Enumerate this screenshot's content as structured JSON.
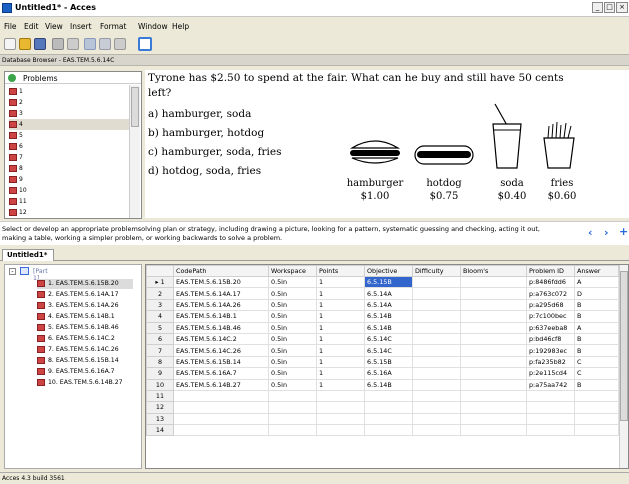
{
  "window": {
    "title": "Untitled1* - Acces",
    "min": "_",
    "max": "□",
    "close": "×"
  },
  "menu": [
    "File",
    "Edit",
    "View",
    "Insert",
    "Format",
    "Window",
    "Help"
  ],
  "database_browser": "Database Browser - EAS.TEM.5.6.14C",
  "problems": {
    "title": "Problems",
    "items": [
      "1",
      "2",
      "3",
      "4",
      "5",
      "6",
      "7",
      "8",
      "9",
      "10",
      "11",
      "12"
    ],
    "selected": "4"
  },
  "question": {
    "line1": "Tyrone has $2.50 to spend at the fair.  What can he buy and still have 50 cents",
    "line2": "left?",
    "options": [
      "a)  hamburger, soda",
      "b)  hamburger, hotdog",
      "c)  hamburger, soda, fries",
      "d)  hotdog, soda, fries"
    ],
    "items": [
      {
        "name": "hamburger",
        "price": "$1.00"
      },
      {
        "name": "hotdog",
        "price": "$0.75"
      },
      {
        "name": "soda",
        "price": "$0.40"
      },
      {
        "name": "fries",
        "price": "$0.60"
      }
    ]
  },
  "strategy": "Select or develop an appropriate problemsolving plan or strategy, including drawing a picture, looking for a pattern, systematic guessing and checking, acting it out, making a table, working a simpler problem, or working backwards to solve a problem.",
  "tab": "Untitled1*",
  "tree": {
    "root": "[Part 1]",
    "children": [
      "1. EAS.TEM.5.6.15B.20",
      "2. EAS.TEM.5.6.14A.17",
      "3. EAS.TEM.5.6.14A.26",
      "4. EAS.TEM.5.6.14B.1",
      "5. EAS.TEM.5.6.14B.46",
      "6. EAS.TEM.5.6.14C.2",
      "7. EAS.TEM.5.6.14C.26",
      "8. EAS.TEM.5.6.15B.14",
      "9. EAS.TEM.5.6.16A.7",
      "10. EAS.TEM.5.6.14B.27"
    ]
  },
  "grid": {
    "columns": [
      "",
      "CodePath",
      "Workspace",
      "Points",
      "Objective",
      "Difficulty",
      "Bloom's",
      "Problem ID",
      "Answer"
    ],
    "rows": [
      [
        "1",
        "EAS.TEM.5.6.15B.20",
        "0.5in",
        "1",
        "6.5.15B",
        "",
        "",
        "p:8486fdd6",
        "A"
      ],
      [
        "2",
        "EAS.TEM.5.6.14A.17",
        "0.5in",
        "1",
        "6.5.14A",
        "",
        "",
        "p:a763c072",
        "D"
      ],
      [
        "3",
        "EAS.TEM.5.6.14A.26",
        "0.5in",
        "1",
        "6.5.14A",
        "",
        "",
        "p:a295d68",
        "B"
      ],
      [
        "4",
        "EAS.TEM.5.6.14B.1",
        "0.5in",
        "1",
        "6.5.14B",
        "",
        "",
        "p:7c100bec",
        "B"
      ],
      [
        "5",
        "EAS.TEM.5.6.14B.46",
        "0.5in",
        "1",
        "6.5.14B",
        "",
        "",
        "p:637eeba8",
        "A"
      ],
      [
        "6",
        "EAS.TEM.5.6.14C.2",
        "0.5in",
        "1",
        "6.5.14C",
        "",
        "",
        "p:bd46cf8",
        "B"
      ],
      [
        "7",
        "EAS.TEM.5.6.14C.26",
        "0.5in",
        "1",
        "6.5.14C",
        "",
        "",
        "p:192983ec",
        "B"
      ],
      [
        "8",
        "EAS.TEM.5.6.15B.14",
        "0.5in",
        "1",
        "6.5.15B",
        "",
        "",
        "p:fa235b82",
        "C"
      ],
      [
        "9",
        "EAS.TEM.5.6.16A.7",
        "0.5in",
        "1",
        "6.5.16A",
        "",
        "",
        "p:2e115cd4",
        "C"
      ],
      [
        "10",
        "EAS.TEM.5.6.14B.27",
        "0.5in",
        "1",
        "6.5.14B",
        "",
        "",
        "p:a75aa742",
        "B"
      ],
      [
        "11",
        "",
        "",
        "",
        "",
        "",
        "",
        "",
        ""
      ],
      [
        "12",
        "",
        "",
        "",
        "",
        "",
        "",
        "",
        ""
      ],
      [
        "13",
        "",
        "",
        "",
        "",
        "",
        "",
        "",
        ""
      ],
      [
        "14",
        "",
        "",
        "",
        "",
        "",
        "",
        "",
        ""
      ]
    ]
  },
  "status": "Acces 4.3 build 3561"
}
